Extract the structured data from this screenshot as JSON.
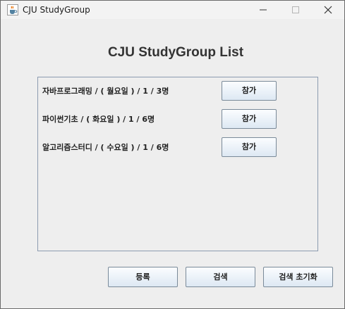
{
  "window": {
    "title": "CJU StudyGroup",
    "icon": "java-cup-icon"
  },
  "main": {
    "heading": "CJU StudyGroup List"
  },
  "groups": [
    {
      "label": "자바프로그래밍 / ( 월요일 ) / 1 / 3명",
      "join_label": "참가"
    },
    {
      "label": "파이썬기초 / ( 화요일 ) / 1 / 6명",
      "join_label": "참가"
    },
    {
      "label": "알고리즘스터디 / ( 수요일 ) / 1 / 6명",
      "join_label": "참가"
    }
  ],
  "actions": {
    "register_label": "등록",
    "search_label": "검색",
    "reset_label": "검색 초기화"
  },
  "colors": {
    "window_bg": "#eeeeee",
    "button_border": "#7a8a99",
    "panel_border": "#8c9bb0"
  }
}
